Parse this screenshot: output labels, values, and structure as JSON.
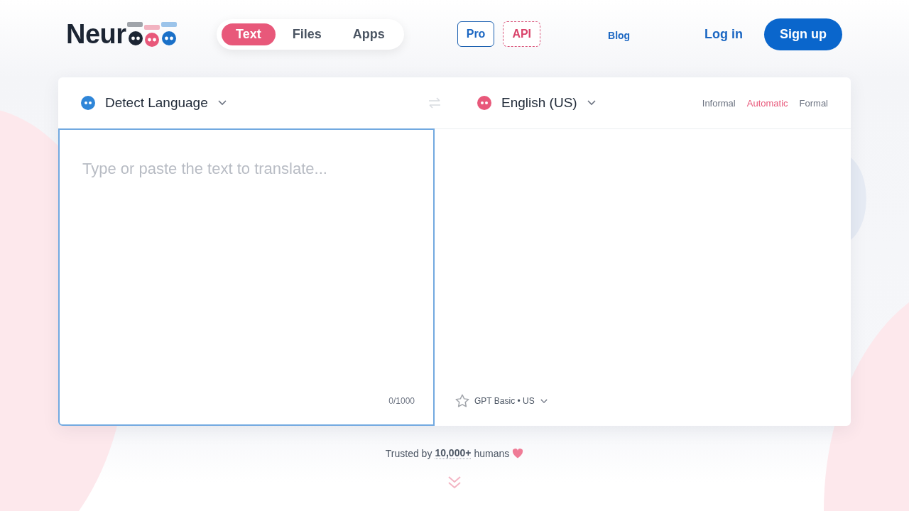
{
  "logo": {
    "text": "Neur"
  },
  "mode_tabs": [
    {
      "label": "Text",
      "selected": true
    },
    {
      "label": "Files",
      "selected": false
    },
    {
      "label": "Apps",
      "selected": false
    }
  ],
  "badges": [
    {
      "label": "Pro",
      "kind": "solid"
    },
    {
      "label": "API",
      "kind": "dashed"
    }
  ],
  "nav": {
    "blog": "Blog",
    "login": "Log in",
    "signup": "Sign up"
  },
  "translator": {
    "source_language": "Detect Language",
    "swap_disabled": true,
    "target_language": "English (US)",
    "tones": [
      {
        "label": "Informal",
        "selected": false
      },
      {
        "label": "Automatic",
        "selected": true
      },
      {
        "label": "Formal",
        "selected": false
      }
    ],
    "input": {
      "placeholder": "Type or paste the text to translate...",
      "counter": "0/1000"
    },
    "model": "GPT Basic • US"
  },
  "trusted": {
    "before": "Trusted by",
    "count": "10,000+",
    "after": "humans"
  }
}
